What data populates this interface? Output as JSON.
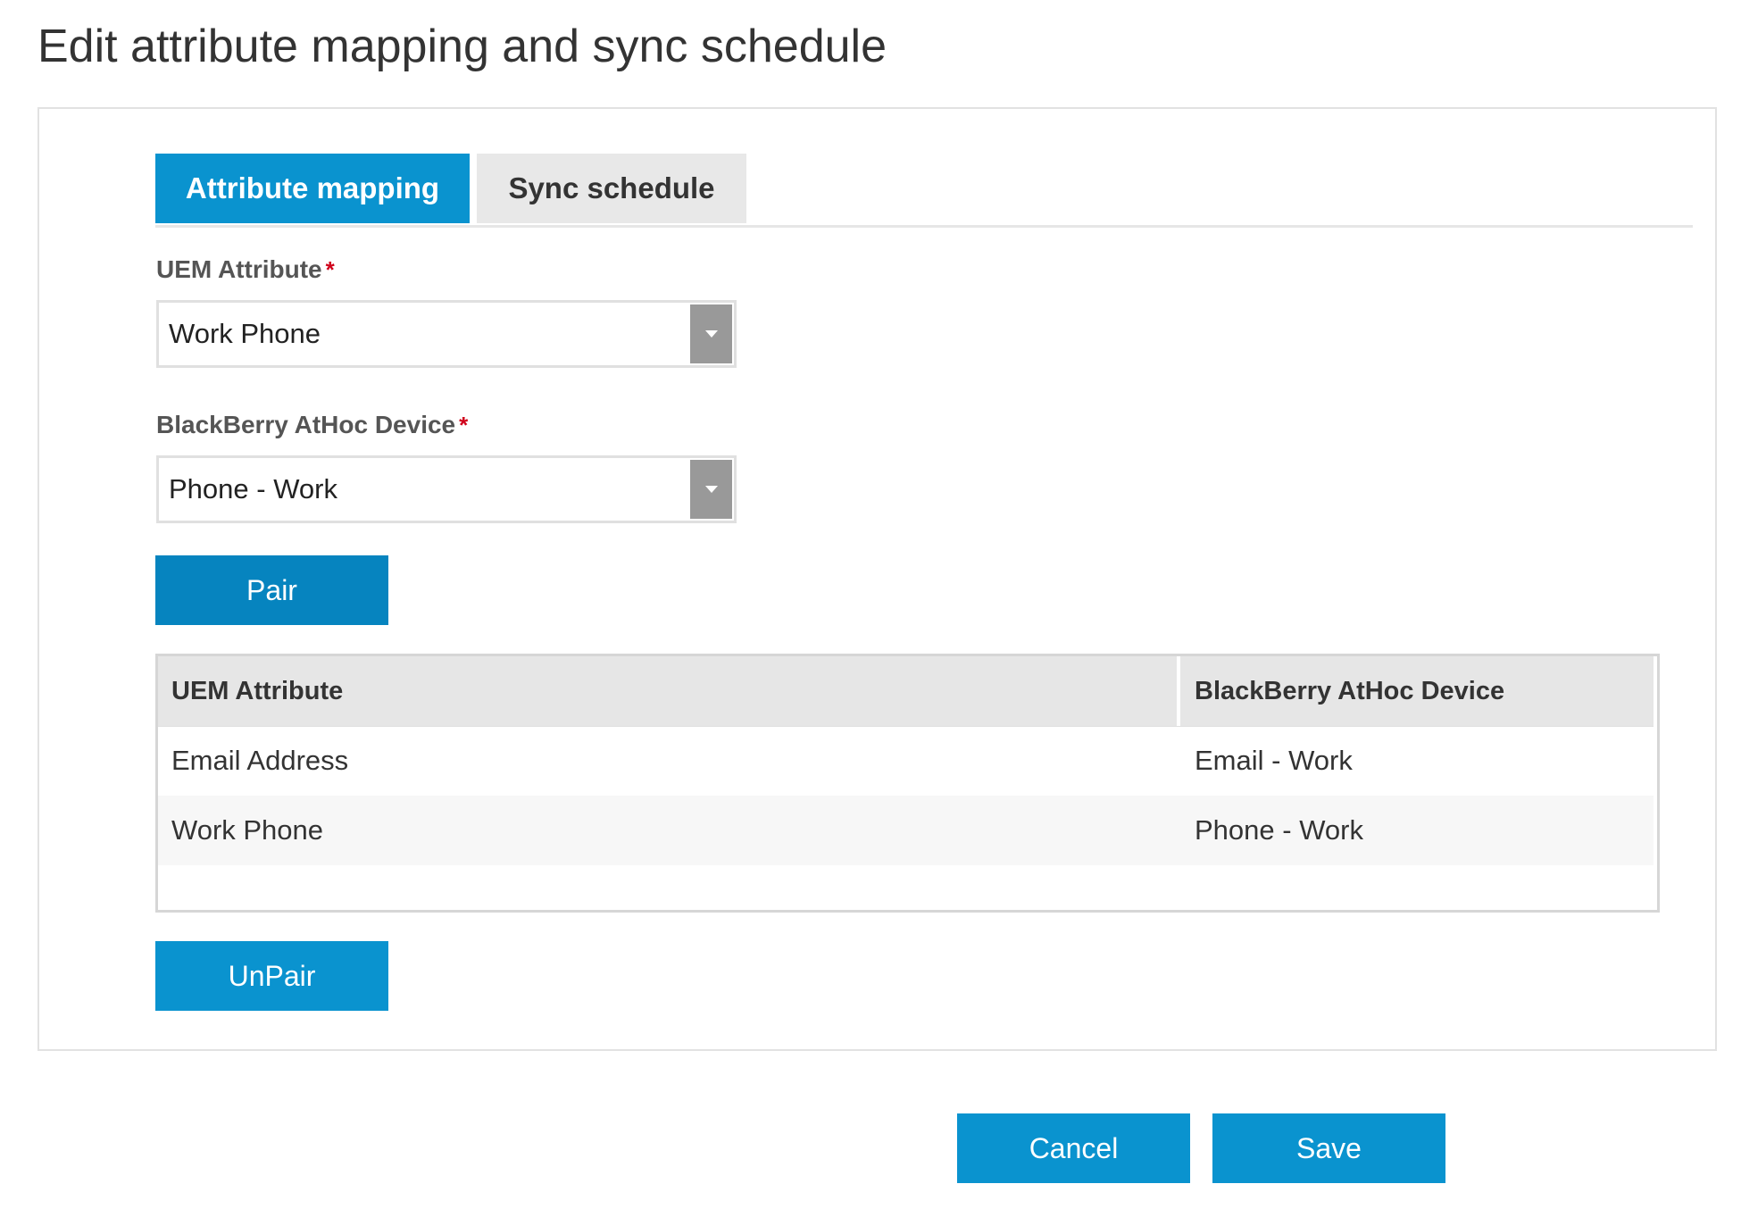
{
  "page": {
    "title": "Edit attribute mapping and sync schedule"
  },
  "tabs": [
    {
      "label": "Attribute mapping",
      "active": true
    },
    {
      "label": "Sync schedule",
      "active": false
    }
  ],
  "form": {
    "uem_attribute": {
      "label": "UEM Attribute",
      "required_mark": "*",
      "selected": "Work Phone"
    },
    "athoc_device": {
      "label": "BlackBerry AtHoc Device",
      "required_mark": "*",
      "selected": "Phone - Work"
    },
    "pair_label": "Pair",
    "unpair_label": "UnPair"
  },
  "mapping_table": {
    "columns": [
      "UEM Attribute",
      "BlackBerry AtHoc Device"
    ],
    "rows": [
      [
        "Email Address",
        "Email - Work"
      ],
      [
        "Work Phone",
        "Phone - Work"
      ]
    ]
  },
  "footer": {
    "cancel_label": "Cancel",
    "save_label": "Save"
  },
  "colors": {
    "accent": "#0a93cf",
    "accent_dark": "#0684bf",
    "required": "#d0021b"
  },
  "icons": {
    "dropdown": "chevron-down-icon"
  }
}
